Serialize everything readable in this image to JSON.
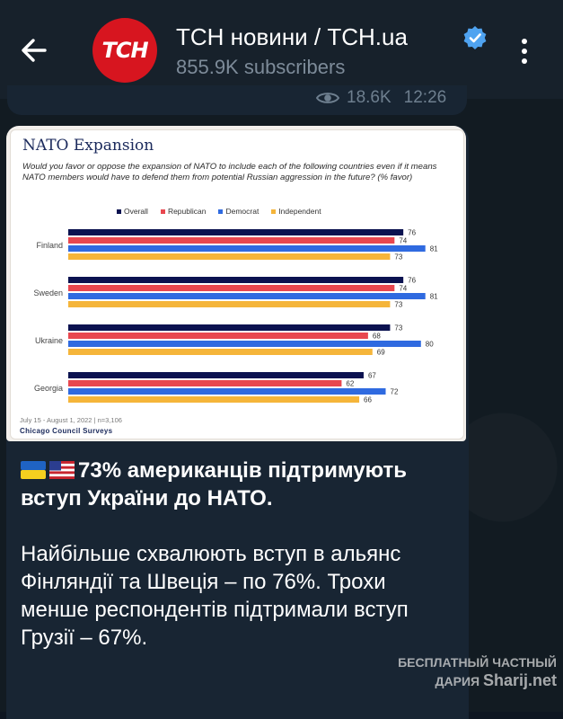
{
  "header": {
    "channel_name": "ТСН новини / ТСН.ua",
    "subscribers": "855.9K subscribers",
    "avatar_text": "ТСН"
  },
  "previous_message": {
    "views": "18.6K",
    "time": "12:26"
  },
  "chart_image": {
    "title": "NATO Expansion",
    "question": "Would you favor or oppose the expansion of NATO to include each of the following countries even if it means NATO members would have to defend them from potential Russian aggression in the future? (% favor)",
    "footnote": "July 15 - August 1, 2022 | n=3,106",
    "brand": "Chicago Council Surveys"
  },
  "chart_data": {
    "type": "bar",
    "orientation": "horizontal",
    "title": "NATO Expansion",
    "categories": [
      "Finland",
      "Sweden",
      "Ukraine",
      "Georgia"
    ],
    "series": [
      {
        "name": "Overall",
        "color": "#0b1250",
        "values": [
          76,
          76,
          73,
          67
        ]
      },
      {
        "name": "Republican",
        "color": "#e8474f",
        "values": [
          74,
          74,
          68,
          62
        ]
      },
      {
        "name": "Democrat",
        "color": "#2f6ae0",
        "values": [
          81,
          81,
          80,
          72
        ]
      },
      {
        "name": "Independent",
        "color": "#f5b53a",
        "values": [
          73,
          73,
          69,
          66
        ]
      }
    ],
    "xlim": [
      0,
      100
    ],
    "legend": "top",
    "grid": false
  },
  "message": {
    "headline": "73% американців підтримують вступ України до НАТО.",
    "body": "Найбільше схвалюють вступ в альянс Фінляндії та Швеція – по 76%. Трохи менше респондентів підтримали вступ Грузії – 67%."
  },
  "watermark": {
    "line1": "БЕСПЛАТНЫЙ ЧАСТНЫЙ",
    "line2": "ДАРИЯ",
    "line3": "Sharij.net"
  },
  "colors": {
    "header_bg": "#17212b",
    "bubble_bg": "#182533",
    "verified": "#4fa3f0",
    "avatar_red": "#d7151f"
  }
}
